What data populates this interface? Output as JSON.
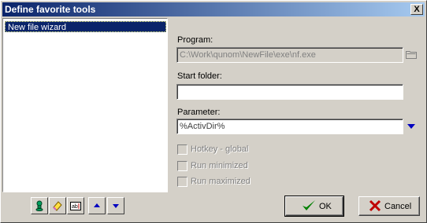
{
  "window": {
    "title": "Define favorite tools",
    "close_glyph": "X"
  },
  "tools_list": {
    "items": [
      {
        "label": "New file wizard",
        "selected": true
      }
    ]
  },
  "form": {
    "program": {
      "label": "Program:",
      "value": "C:\\Work\\qunom\\NewFile\\exe\\nf.exe"
    },
    "start_folder": {
      "label": "Start folder:",
      "value": ""
    },
    "parameter": {
      "label": "Parameter:",
      "value": "%ActivDir%"
    },
    "options": [
      {
        "label": "Hotkey - global",
        "checked": false
      },
      {
        "label": "Run minimized",
        "checked": false
      },
      {
        "label": "Run maximized",
        "checked": false
      }
    ]
  },
  "toolbar": {
    "icons": [
      "add-tool-icon",
      "erase-tool-icon",
      "rename-tool-icon",
      "move-up-icon",
      "move-down-icon"
    ]
  },
  "buttons": {
    "ok_label": "OK",
    "cancel_label": "Cancel"
  },
  "colors": {
    "selection": "#0a246a",
    "ok_check": "#008000",
    "cancel_x": "#c00000",
    "arrow": "#0000c0"
  }
}
